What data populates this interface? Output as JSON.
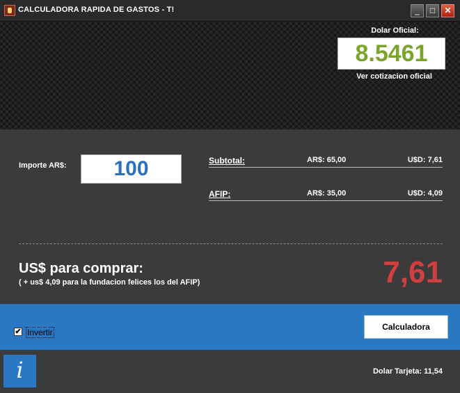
{
  "window": {
    "title": "CALCULADORA RAPIDA DE GASTOS - T!",
    "controls": {
      "minimize": "_",
      "maximize": "□",
      "close": "✕"
    }
  },
  "header": {
    "dolar_label": "Dolar Oficial:",
    "dolar_value": "8.5461",
    "link_text": "Ver cotizacion oficial",
    "value_color": "#7aa52a"
  },
  "importe": {
    "label": "Importe AR$:",
    "value": "100"
  },
  "rows": {
    "subtotal": {
      "label": "Subtotal:",
      "ars": "AR$: 65,00",
      "usd": "U$D: 7,61"
    },
    "afip": {
      "label": "AFIP:",
      "ars": "AR$: 35,00",
      "usd": "U$D: 4,09"
    }
  },
  "result": {
    "title": "US$ para comprar:",
    "subtitle": "( + us$ 4,09 para la fundacion felices los del AFIP)",
    "value": "7,61",
    "value_color": "#d04040"
  },
  "bar": {
    "invertir_label": "Invertir",
    "invertir_checked": true,
    "calc_button": "Calculadora",
    "color": "#2a77c4"
  },
  "footer": {
    "info_icon": "info-icon",
    "tarjeta_label": "Dolar Tarjeta:",
    "tarjeta_value": "11,54"
  }
}
